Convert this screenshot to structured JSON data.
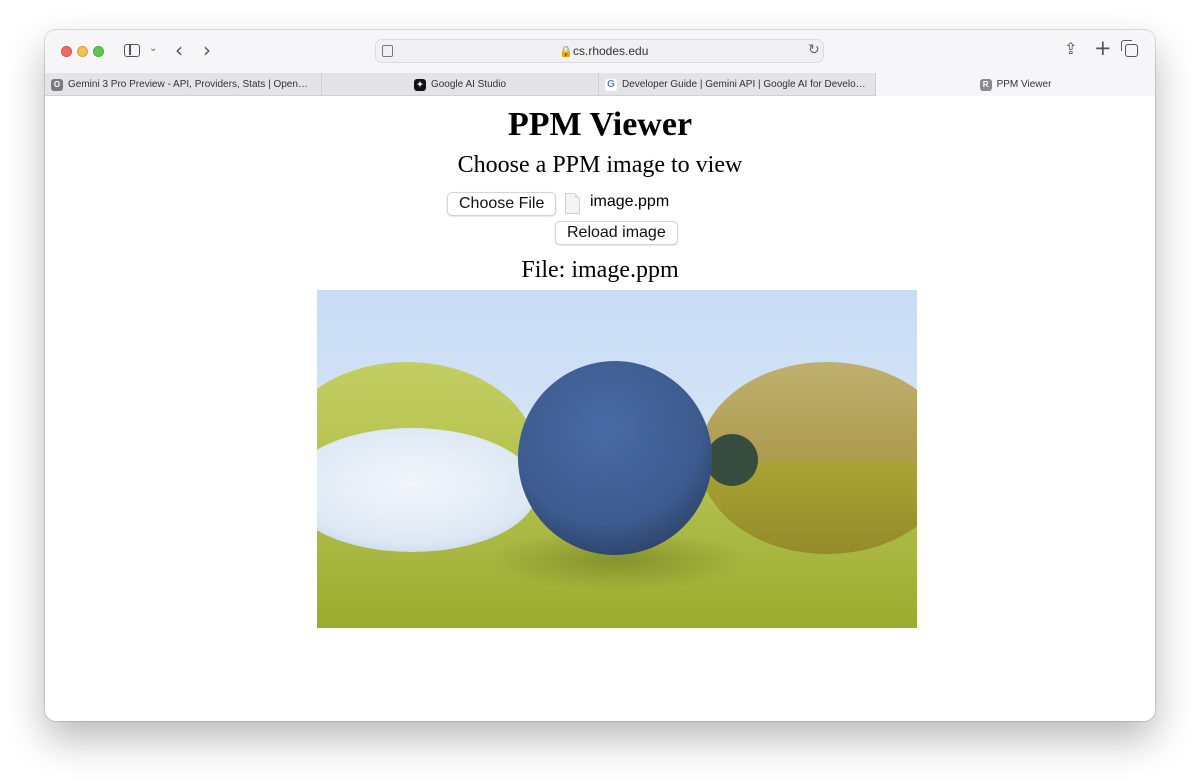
{
  "browser": {
    "url": "cs.rhodes.edu",
    "tabs": [
      {
        "label": "Gemini 3 Pro Preview - API, Providers, Stats | OpenRou…",
        "favicon": "openrouter-icon"
      },
      {
        "label": "Google AI Studio",
        "favicon": "ai-studio-icon"
      },
      {
        "label": "Developer Guide  |  Gemini API  |  Google AI for Develop…",
        "favicon": "google-icon"
      },
      {
        "label": "PPM Viewer",
        "favicon": "R",
        "active": true
      }
    ]
  },
  "page": {
    "title": "PPM Viewer",
    "subtitle": "Choose a PPM image to view",
    "choose_file_label": "Choose File",
    "selected_file": "image.ppm",
    "reload_label": "Reload image",
    "file_label": "File: image.ppm"
  },
  "colors": {
    "sky": "#cfe0f7",
    "ground": "#a8b83a",
    "center_sphere": "#3f5f95",
    "glass_sphere": "#e6eef8",
    "left_sphere": "#b4c14a",
    "right_sphere": "#a99647"
  }
}
